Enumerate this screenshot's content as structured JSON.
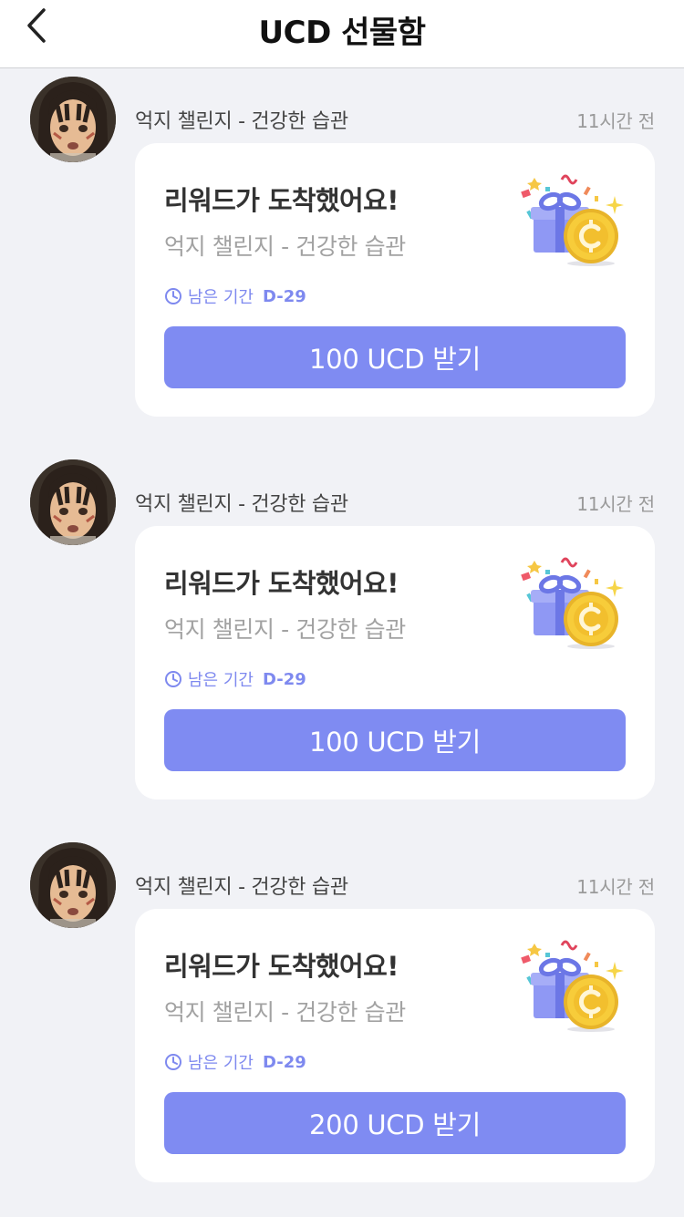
{
  "header": {
    "title": "UCD 선물함",
    "back_icon": "chevron-left-icon"
  },
  "colors": {
    "accent": "#7f8bf2",
    "deadline_text": "#7e89ef",
    "page_background": "#f1f2f6"
  },
  "items": [
    {
      "source": "억지 챌린지 - 건강한 습관",
      "time": "11시간 전",
      "title": "리워드가 도착했어요!",
      "subtitle": "억지 챌린지 - 건강한 습관",
      "deadline_label": "남은 기간",
      "deadline_value": "D-29",
      "button_label": "100 UCD 받기",
      "image_icon": "gift-coin-icon"
    },
    {
      "source": "억지 챌린지 - 건강한 습관",
      "time": "11시간 전",
      "title": "리워드가 도착했어요!",
      "subtitle": "억지 챌린지 - 건강한 습관",
      "deadline_label": "남은 기간",
      "deadline_value": "D-29",
      "button_label": "100 UCD 받기",
      "image_icon": "gift-coin-icon"
    },
    {
      "source": "억지 챌린지 - 건강한 습관",
      "time": "11시간 전",
      "title": "리워드가 도착했어요!",
      "subtitle": "억지 챌린지 - 건강한 습관",
      "deadline_label": "남은 기간",
      "deadline_value": "D-29",
      "button_label": "200 UCD 받기",
      "image_icon": "gift-coin-icon"
    }
  ]
}
